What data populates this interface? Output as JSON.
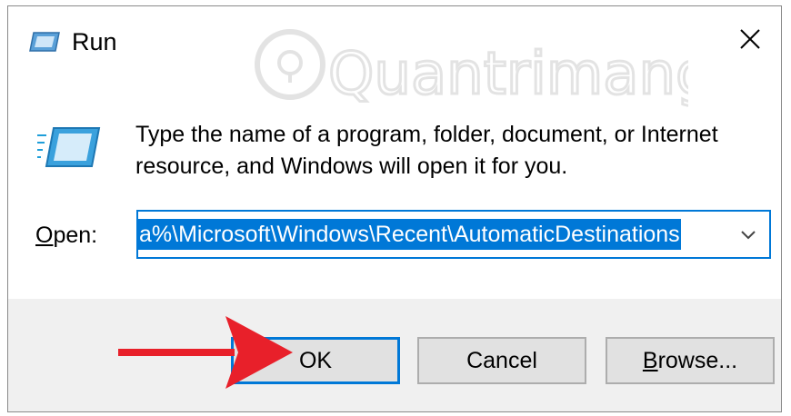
{
  "window": {
    "title": "Run"
  },
  "main": {
    "instructions": "Type the name of a program, folder, document, or Internet resource, and Windows will open it for you.",
    "open_label_mnemonic": "O",
    "open_label_rest": "pen:",
    "open_value": "a%\\Microsoft\\Windows\\Recent\\AutomaticDestinations"
  },
  "buttons": {
    "ok": "OK",
    "cancel": "Cancel",
    "browse_mnemonic": "B",
    "browse_rest": "rowse..."
  },
  "watermark": {
    "text": "Quantrimang"
  },
  "icons": {
    "title": "run-icon",
    "close": "close-icon",
    "main": "run-icon",
    "dropdown": "chevron-down-icon",
    "annotation": "arrow-icon"
  },
  "colors": {
    "accent": "#0078d7",
    "selection": "#0078d7",
    "footer": "#f0f0f0",
    "button_face": "#e1e1e1",
    "annotation_arrow": "#e8202a"
  }
}
